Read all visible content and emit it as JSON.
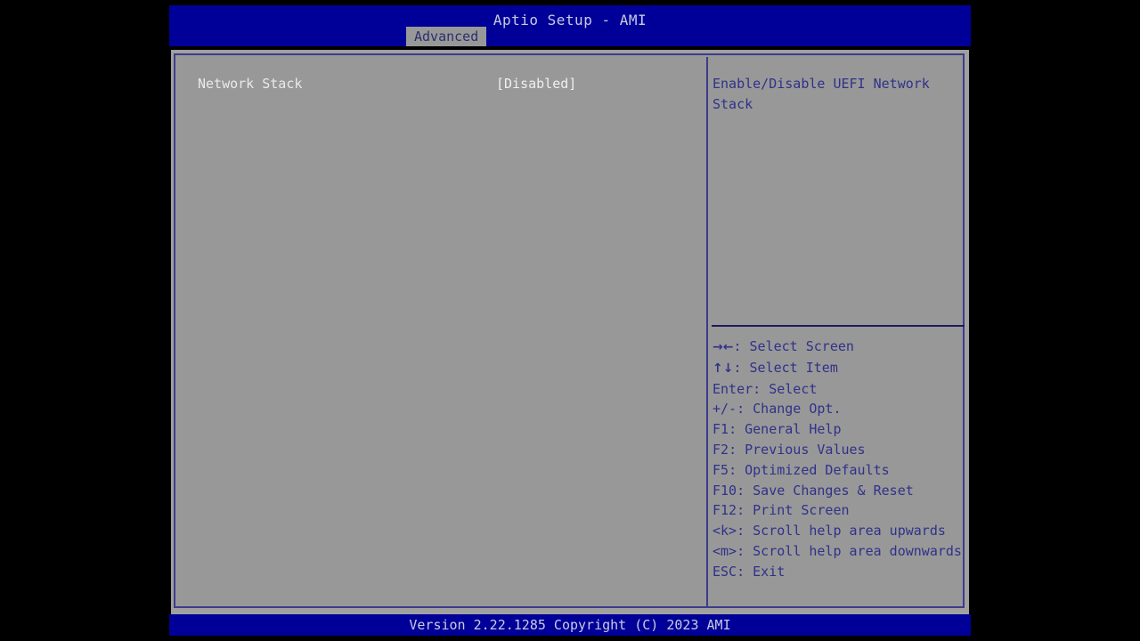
{
  "header": {
    "title": "Aptio Setup - AMI",
    "active_tab": "Advanced",
    "bar_color": "#000099",
    "tab_bg_color": "#989898",
    "tab_text_color": "#2b2f6e"
  },
  "settings": {
    "rows": [
      {
        "label": "Network Stack",
        "value": "[Disabled]"
      }
    ]
  },
  "help": {
    "description": "Enable/Disable UEFI Network Stack",
    "text_color": "#30318a",
    "legend": [
      {
        "glyph": "→←",
        "key": "",
        "sep": ": ",
        "action": "Select Screen"
      },
      {
        "glyph": "↑↓",
        "key": "",
        "sep": ": ",
        "action": "Select Item"
      },
      {
        "glyph": "",
        "key": "Enter",
        "sep": ": ",
        "action": "Select"
      },
      {
        "glyph": "",
        "key": "+/-",
        "sep": ": ",
        "action": "Change Opt."
      },
      {
        "glyph": "",
        "key": "F1",
        "sep": ": ",
        "action": "General Help"
      },
      {
        "glyph": "",
        "key": "F2",
        "sep": ": ",
        "action": "Previous Values"
      },
      {
        "glyph": "",
        "key": "F5",
        "sep": ": ",
        "action": "Optimized Defaults"
      },
      {
        "glyph": "",
        "key": "F10",
        "sep": ": ",
        "action": "Save Changes & Reset"
      },
      {
        "glyph": "",
        "key": "F12",
        "sep": ": ",
        "action": "Print Screen"
      },
      {
        "glyph": "",
        "key": "<k>",
        "sep": ": ",
        "action": "Scroll help area upwards"
      },
      {
        "glyph": "",
        "key": "<m>",
        "sep": ": ",
        "action": "Scroll help area downwards"
      },
      {
        "glyph": "",
        "key": "ESC",
        "sep": ": ",
        "action": "Exit"
      }
    ]
  },
  "footer": {
    "version_text": "Version 2.22.1285 Copyright (C) 2023 AMI",
    "bar_color": "#000099"
  },
  "theme": {
    "panel_bg": "#989898",
    "border_color": "#3c3c8c",
    "screen_bg": "#000000"
  }
}
